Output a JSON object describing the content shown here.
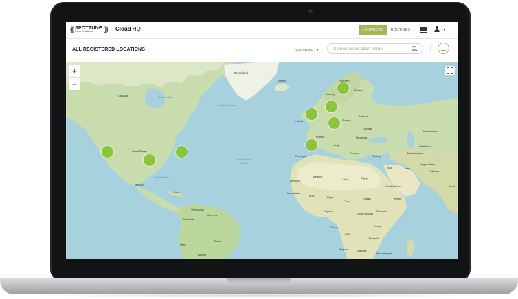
{
  "window": {
    "logo_text": "SPOTTUNE",
    "logo_sub": "Great Experience",
    "app_name_bold": "Cloud",
    "app_name_rest": " HQ"
  },
  "nav": {
    "tabs": [
      {
        "label": "LOCATIONS",
        "active": true
      },
      {
        "label": "ROUTINES",
        "active": false
      }
    ]
  },
  "header": {
    "title": "ALL REGISTERED LOCATIONS",
    "advanced_label": "ADVANCED",
    "search_placeholder": "Search on location name"
  },
  "map": {
    "zoom_in": "+",
    "zoom_out": "−",
    "labels": {
      "greenland": "Greenland",
      "iceland": "Iceland",
      "canada": "Canada",
      "hudson_bay": "Hudson Bay",
      "labrador_sea": "Labrador Sea",
      "united_states": "United States",
      "mexico": "Mexico",
      "cuba": "Cuba",
      "gulf_of_mexico": "Gulf of Mexico",
      "venezuela": "Venezuela",
      "colombia": "Colombia",
      "guyana": "Guyana",
      "brazil": "Brazil",
      "peru": "Peru",
      "bolivia": "Bolivia",
      "ocean": "North Atlantic Ocean",
      "sweden": "Sweden",
      "finland": "Finland",
      "norway": "Norway",
      "ireland": "Ireland",
      "poland": "Poland",
      "belarus": "Belarus",
      "ukraine": "Ukraine",
      "france": "France",
      "italy": "Italy",
      "romania": "Romania",
      "portugal": "Portugal",
      "greece": "Greece",
      "turkey": "Turkey",
      "kazakhstan": "Kazakhstan",
      "uzbekistan": "Uzbekistan",
      "turkmenistan": "Turkmenistan",
      "afghanistan": "Afghanistan",
      "pakistan": "Pakistan",
      "iraq": "Iraq",
      "iran": "Iran",
      "india": "India",
      "morocco": "Morocco",
      "algeria": "Algeria",
      "libya": "Libya",
      "egypt": "Egypt",
      "saudi_arabia": "Saudi Arabia",
      "yemen": "Yemen",
      "mauritania": "Mauritania",
      "mali": "Mali",
      "niger": "Niger",
      "chad": "Chad",
      "sudan": "Sudan",
      "nigeria": "Nigeria",
      "ethiopia": "Ethiopia",
      "south_sudan": "South Sudan",
      "gabon": "Gabon",
      "drc": "DRC",
      "kenya": "Kenya",
      "tanzania": "Tanzania",
      "angola": "Angola",
      "zambia": "Zambia",
      "mozambique": "Mozambique"
    },
    "marker_color": "#8cc43c"
  },
  "colors": {
    "accent": "#a6b45a",
    "water": "#a7d2dd",
    "land": "#c9dcae"
  }
}
